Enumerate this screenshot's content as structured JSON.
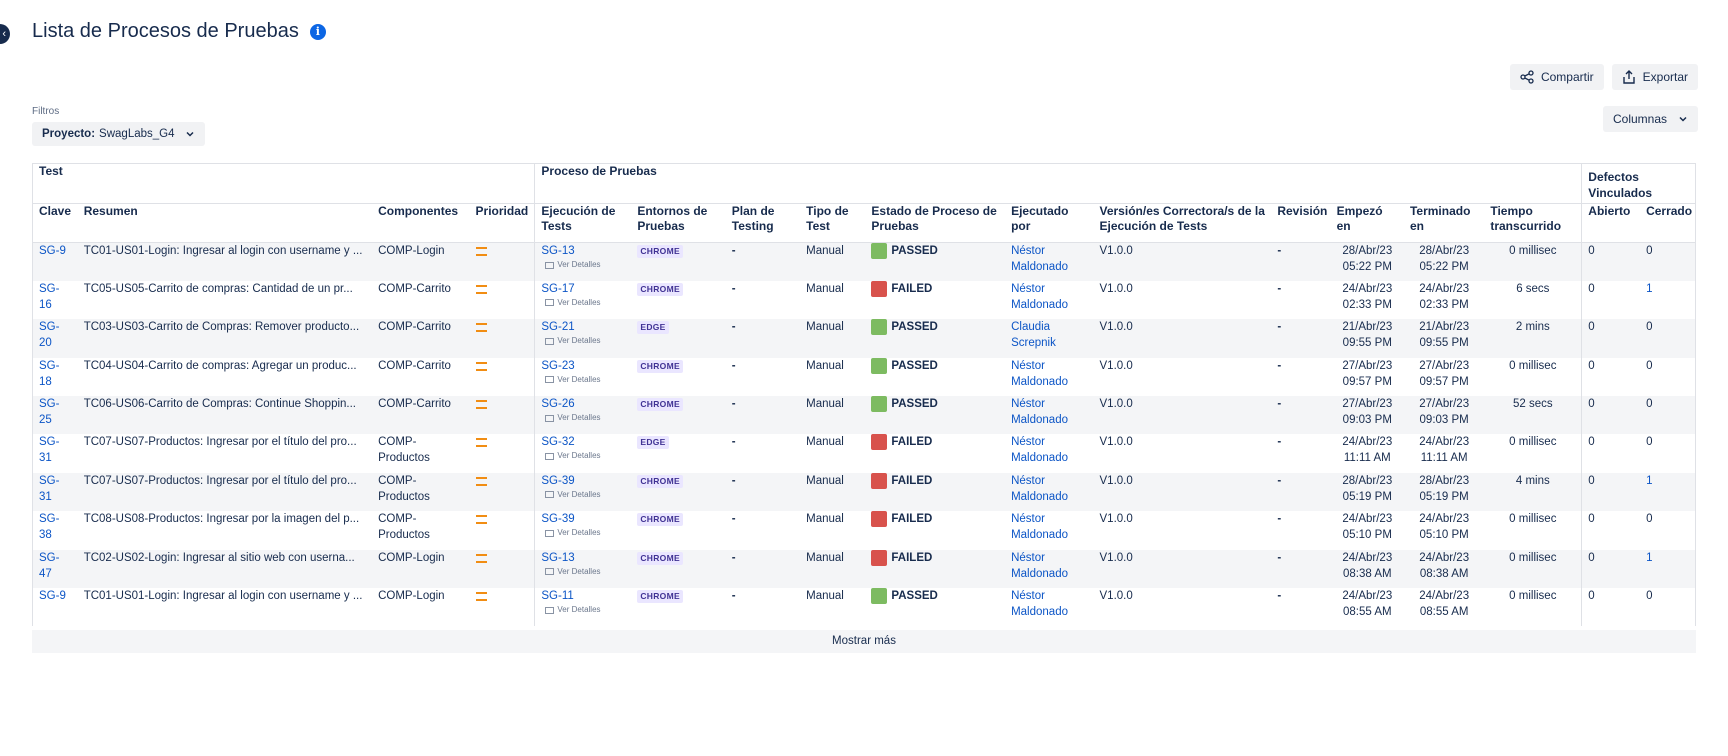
{
  "header": {
    "title": "Lista de Procesos de Pruebas",
    "info_icon": "i"
  },
  "toolbar": {
    "share_label": "Compartir",
    "export_label": "Exportar",
    "columns_label": "Columnas"
  },
  "filters": {
    "label": "Filtros",
    "project_key": "Proyecto:",
    "project_value": "SwagLabs_G4"
  },
  "groups": {
    "test": "Test",
    "process": "Proceso de Pruebas",
    "defects": "Defectos Vinculados"
  },
  "columns": {
    "clave": "Clave",
    "resumen": "Resumen",
    "componentes": "Componentes",
    "prioridad": "Prioridad",
    "ejecucion": "Ejecución de Tests",
    "entornos": "Entornos de Pruebas",
    "plan": "Plan de Testing",
    "tipo": "Tipo de Test",
    "estado": "Estado de Proceso de Pruebas",
    "ejecutado": "Ejecutado por",
    "version": "Versión/es Correctora/s de la Ejecución de Tests",
    "revision": "Revisión",
    "empezo": "Empezó en",
    "terminado": "Terminado en",
    "tiempo": "Tiempo transcurrido",
    "abierto": "Abierto",
    "cerrado": "Cerrado"
  },
  "details_label": "Ver Detalles",
  "rows": [
    {
      "clave": "SG-9",
      "resumen": "TC01-US01-Login: Ingresar al login con username y ...",
      "componentes": "COMP-Login",
      "ejecucion": "SG-13",
      "entorno": "CHROME",
      "plan": "-",
      "tipo": "Manual",
      "estado": "PASSED",
      "ejecutado": "Néstor Maldonado",
      "version": "V1.0.0",
      "revision": "-",
      "empezo": "28/Abr/23 05:22 PM",
      "terminado": "28/Abr/23 05:22 PM",
      "tiempo": "0 millisec",
      "abierto": "0",
      "cerrado": "0"
    },
    {
      "clave": "SG-16",
      "resumen": "TC05-US05-Carrito de compras: Cantidad de un pr...",
      "componentes": "COMP-Carrito",
      "ejecucion": "SG-17",
      "entorno": "CHROME",
      "plan": "-",
      "tipo": "Manual",
      "estado": "FAILED",
      "ejecutado": "Néstor Maldonado",
      "version": "V1.0.0",
      "revision": "-",
      "empezo": "24/Abr/23 02:33 PM",
      "terminado": "24/Abr/23 02:33 PM",
      "tiempo": "6 secs",
      "abierto": "0",
      "cerrado": "1"
    },
    {
      "clave": "SG-20",
      "resumen": "TC03-US03-Carrito de Compras: Remover producto...",
      "componentes": "COMP-Carrito",
      "ejecucion": "SG-21",
      "entorno": "EDGE",
      "plan": "-",
      "tipo": "Manual",
      "estado": "PASSED",
      "ejecutado": "Claudia Screpnik",
      "version": "V1.0.0",
      "revision": "-",
      "empezo": "21/Abr/23 09:55 PM",
      "terminado": "21/Abr/23 09:55 PM",
      "tiempo": "2 mins",
      "abierto": "0",
      "cerrado": "0"
    },
    {
      "clave": "SG-18",
      "resumen": "TC04-US04-Carrito de compras: Agregar un produc...",
      "componentes": "COMP-Carrito",
      "ejecucion": "SG-23",
      "entorno": "CHROME",
      "plan": "-",
      "tipo": "Manual",
      "estado": "PASSED",
      "ejecutado": "Néstor Maldonado",
      "version": "V1.0.0",
      "revision": "-",
      "empezo": "27/Abr/23 09:57 PM",
      "terminado": "27/Abr/23 09:57 PM",
      "tiempo": "0 millisec",
      "abierto": "0",
      "cerrado": "0"
    },
    {
      "clave": "SG-25",
      "resumen": "TC06-US06-Carrito de Compras: Continue Shoppin...",
      "componentes": "COMP-Carrito",
      "ejecucion": "SG-26",
      "entorno": "CHROME",
      "plan": "-",
      "tipo": "Manual",
      "estado": "PASSED",
      "ejecutado": "Néstor Maldonado",
      "version": "V1.0.0",
      "revision": "-",
      "empezo": "27/Abr/23 09:03 PM",
      "terminado": "27/Abr/23 09:03 PM",
      "tiempo": "52 secs",
      "abierto": "0",
      "cerrado": "0"
    },
    {
      "clave": "SG-31",
      "resumen": "TC07-US07-Productos: Ingresar por el título del pro...",
      "componentes": "COMP-Productos",
      "ejecucion": "SG-32",
      "entorno": "EDGE",
      "plan": "-",
      "tipo": "Manual",
      "estado": "FAILED",
      "ejecutado": "Néstor Maldonado",
      "version": "V1.0.0",
      "revision": "-",
      "empezo": "24/Abr/23 11:11 AM",
      "terminado": "24/Abr/23 11:11 AM",
      "tiempo": "0 millisec",
      "abierto": "0",
      "cerrado": "0"
    },
    {
      "clave": "SG-31",
      "resumen": "TC07-US07-Productos: Ingresar por el título del pro...",
      "componentes": "COMP-Productos",
      "ejecucion": "SG-39",
      "entorno": "CHROME",
      "plan": "-",
      "tipo": "Manual",
      "estado": "FAILED",
      "ejecutado": "Néstor Maldonado",
      "version": "V1.0.0",
      "revision": "-",
      "empezo": "28/Abr/23 05:19 PM",
      "terminado": "28/Abr/23 05:19 PM",
      "tiempo": "4 mins",
      "abierto": "0",
      "cerrado": "1"
    },
    {
      "clave": "SG-38",
      "resumen": "TC08-US08-Productos: Ingresar por la imagen del p...",
      "componentes": "COMP-Productos",
      "ejecucion": "SG-39",
      "entorno": "CHROME",
      "plan": "-",
      "tipo": "Manual",
      "estado": "FAILED",
      "ejecutado": "Néstor Maldonado",
      "version": "V1.0.0",
      "revision": "-",
      "empezo": "24/Abr/23 05:10 PM",
      "terminado": "24/Abr/23 05:10 PM",
      "tiempo": "0 millisec",
      "abierto": "0",
      "cerrado": "0"
    },
    {
      "clave": "SG-47",
      "resumen": "TC02-US02-Login: Ingresar al sitio web con userna...",
      "componentes": "COMP-Login",
      "ejecucion": "SG-13",
      "entorno": "CHROME",
      "plan": "-",
      "tipo": "Manual",
      "estado": "FAILED",
      "ejecutado": "Néstor Maldonado",
      "version": "V1.0.0",
      "revision": "-",
      "empezo": "24/Abr/23 08:38 AM",
      "terminado": "24/Abr/23 08:38 AM",
      "tiempo": "0 millisec",
      "abierto": "0",
      "cerrado": "1"
    },
    {
      "clave": "SG-9",
      "resumen": "TC01-US01-Login: Ingresar al login con username y ...",
      "componentes": "COMP-Login",
      "ejecucion": "SG-11",
      "entorno": "CHROME",
      "plan": "-",
      "tipo": "Manual",
      "estado": "PASSED",
      "ejecutado": "Néstor Maldonado",
      "version": "V1.0.0",
      "revision": "-",
      "empezo": "24/Abr/23 08:55 AM",
      "terminado": "24/Abr/23 08:55 AM",
      "tiempo": "0 millisec",
      "abierto": "0",
      "cerrado": "0"
    }
  ],
  "show_more": "Mostrar más",
  "colors": {
    "link": "#0c55c6",
    "passed": "#7dbb61",
    "failed": "#d8524c",
    "priority": "#f18d13",
    "badge_bg": "#eae6ff",
    "badge_text": "#403294"
  }
}
